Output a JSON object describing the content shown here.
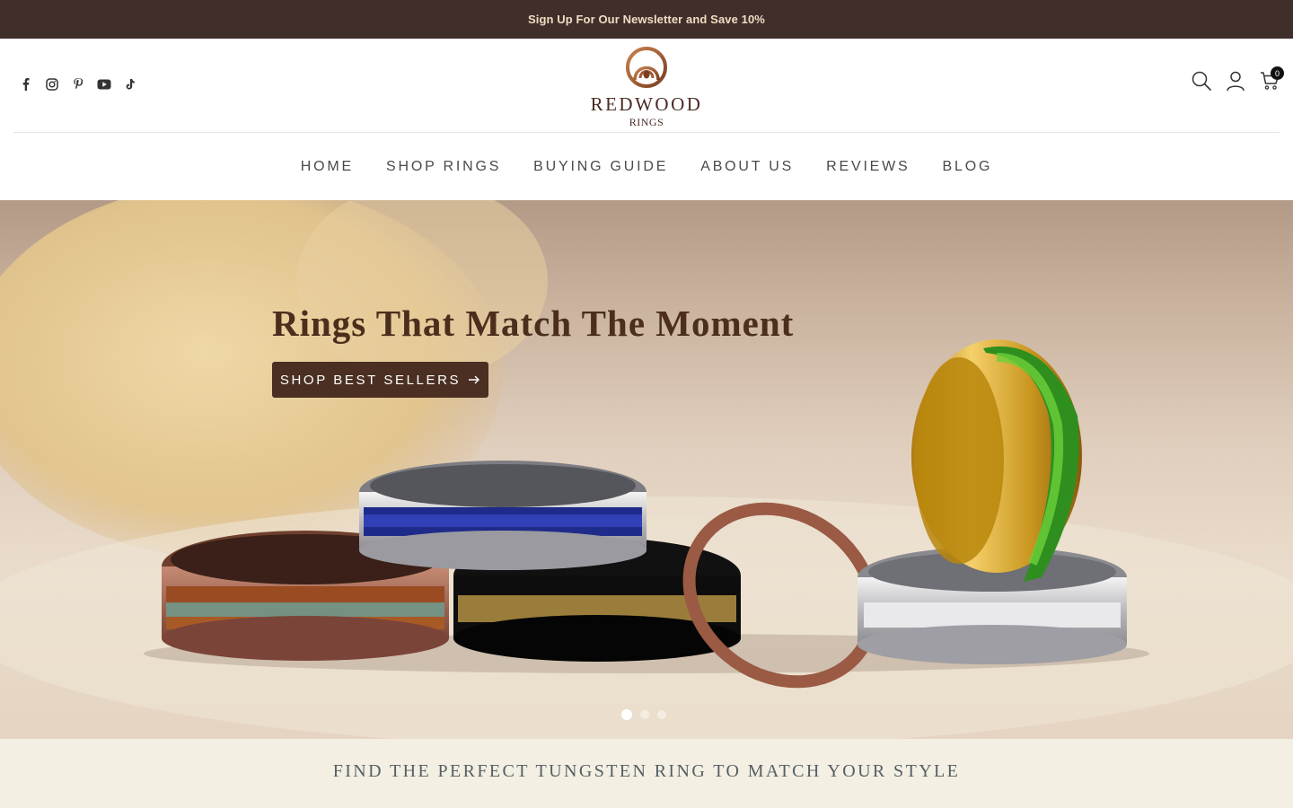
{
  "announcement": {
    "text": "Sign Up For Our Newsletter and Save 10%"
  },
  "header": {
    "social": [
      {
        "icon": "facebook-icon",
        "glyph": "f"
      },
      {
        "icon": "instagram-icon"
      },
      {
        "icon": "pinterest-icon"
      },
      {
        "icon": "youtube-icon"
      },
      {
        "icon": "tiktok-icon"
      }
    ],
    "logo": {
      "brand": "REDWOOD",
      "sub": "RINGS"
    },
    "actions": {
      "cart_count": "0"
    }
  },
  "nav": {
    "items": [
      {
        "label": "HOME"
      },
      {
        "label": "SHOP RINGS"
      },
      {
        "label": "BUYING GUIDE"
      },
      {
        "label": "ABOUT US"
      },
      {
        "label": "REVIEWS"
      },
      {
        "label": "BLOG"
      }
    ]
  },
  "hero": {
    "title": "Rings That Match The Moment",
    "cta_label": "SHOP BEST SELLERS",
    "slides_total": 3,
    "active_slide": 1
  },
  "band": {
    "text": "FIND THE PERFECT TUNGSTEN RING TO MATCH YOUR STYLE"
  },
  "colors": {
    "announcement_bg": "#3f2e2a",
    "announcement_text": "#f1dcc2",
    "cta_bg": "#4a2f22",
    "hero_title": "#4b2e1c",
    "band_bg": "#f4efe3"
  }
}
